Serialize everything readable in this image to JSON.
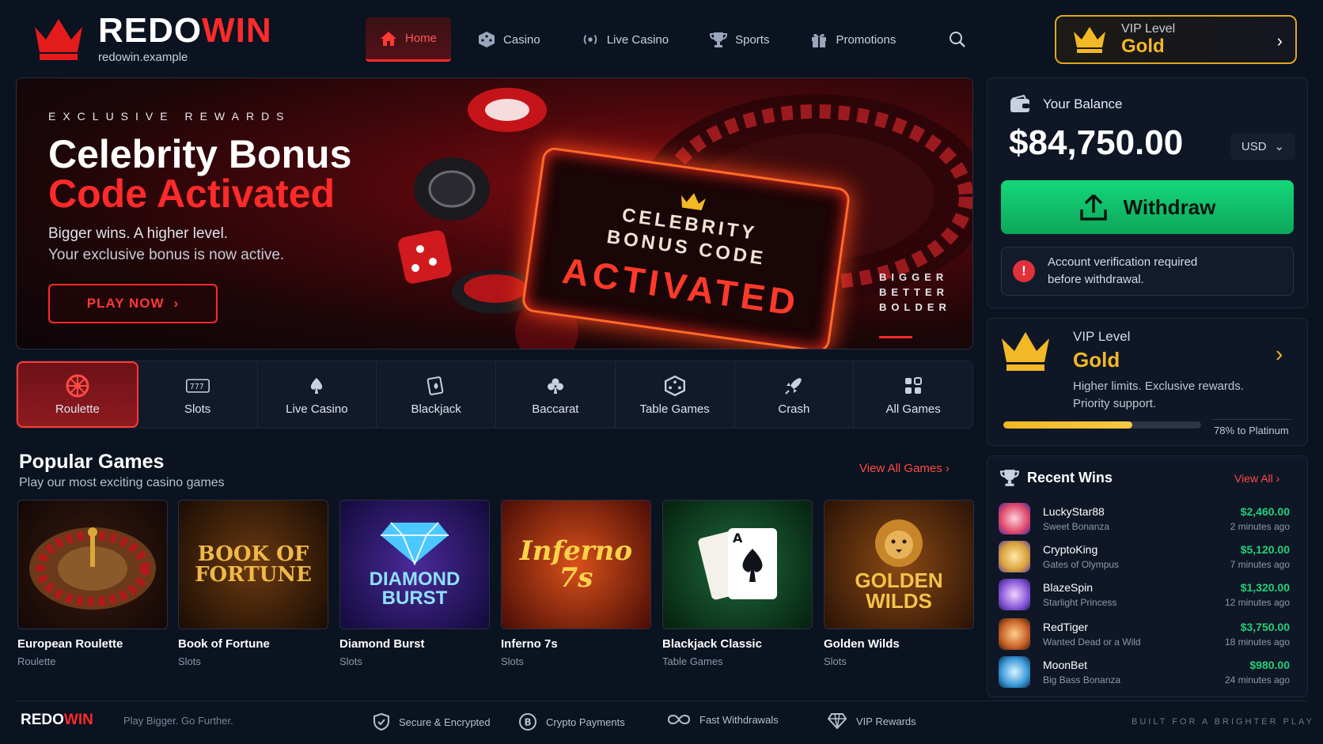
{
  "brand": {
    "word1": "REDO",
    "word2": "WIN",
    "domain": "redowin.example"
  },
  "nav": {
    "items": [
      {
        "label": "Home",
        "icon": "home-icon"
      },
      {
        "label": "Casino",
        "icon": "dice-icon"
      },
      {
        "label": "Live Casino",
        "icon": "broadcast-icon"
      },
      {
        "label": "Sports",
        "icon": "trophy-icon"
      },
      {
        "label": "Promotions",
        "icon": "gift-icon"
      }
    ],
    "active": "Home",
    "search_icon": "search-icon"
  },
  "vip_header": {
    "label": "VIP Level",
    "level": "Gold"
  },
  "hero": {
    "kicker": "EXCLUSIVE REWARDS",
    "title_line1": "Celebrity Bonus",
    "title_line2": "Code Activated",
    "sub1": "Bigger wins. A higher level.",
    "sub2": "Your exclusive bonus is now active.",
    "cta": "PLAY NOW",
    "ticket_line1": "CELEBRITY",
    "ticket_line2": "BONUS CODE",
    "ticket_line3": "ACTIVATED",
    "side": [
      "BIGGER",
      "BETTER",
      "BOLDER"
    ]
  },
  "categories": [
    {
      "label": "Roulette",
      "icon": "roulette-icon"
    },
    {
      "label": "Slots",
      "icon": "slot-machine-icon"
    },
    {
      "label": "Live Casino",
      "icon": "spade-icon"
    },
    {
      "label": "Blackjack",
      "icon": "cards-icon"
    },
    {
      "label": "Baccarat",
      "icon": "club-icon"
    },
    {
      "label": "Table Games",
      "icon": "dice-icon"
    },
    {
      "label": "Crash",
      "icon": "rocket-icon"
    },
    {
      "label": "All Games",
      "icon": "grid-icon"
    }
  ],
  "popular": {
    "title": "Popular Games",
    "subtitle": "Play our most exciting casino games",
    "view_all": "View All Games",
    "games": [
      {
        "name": "European Roulette",
        "category": "Roulette",
        "thumb_text": ""
      },
      {
        "name": "Book of Fortune",
        "category": "Slots",
        "thumb_text": "BOOK OF FORTUNE"
      },
      {
        "name": "Diamond Burst",
        "category": "Slots",
        "thumb_text": "DIAMOND BURST"
      },
      {
        "name": "Inferno 7s",
        "category": "Slots",
        "thumb_text": "Inferno 7s"
      },
      {
        "name": "Blackjack Classic",
        "category": "Table Games",
        "thumb_text": ""
      },
      {
        "name": "Golden Wilds",
        "category": "Slots",
        "thumb_text": "GOLDEN WILDS"
      }
    ]
  },
  "balance": {
    "label": "Your Balance",
    "amount": "$84,750.00",
    "currency": "USD",
    "withdraw": "Withdraw",
    "verify_line1": "Account verification required",
    "verify_line2": "before withdrawal."
  },
  "vip_card": {
    "label": "VIP Level",
    "level": "Gold",
    "desc1": "Higher limits. Exclusive rewards.",
    "desc2": "Priority support.",
    "progress": 0.65,
    "progress_label": "78% to Platinum"
  },
  "recent_wins": {
    "title": "Recent Wins",
    "view_all": "View All",
    "rows": [
      {
        "user": "LuckyStar88",
        "game": "Sweet Bonanza",
        "amount": "$2,460.00",
        "time": "2 minutes ago",
        "color": "#e24a6a"
      },
      {
        "user": "CryptoKing",
        "game": "Gates of Olympus",
        "amount": "$5,120.00",
        "time": "7 minutes ago",
        "color": "#d9a13a"
      },
      {
        "user": "BlazeSpin",
        "game": "Starlight Princess",
        "amount": "$1,320.00",
        "time": "12 minutes ago",
        "color": "#8a5ad8"
      },
      {
        "user": "RedTiger",
        "game": "Wanted Dead or a Wild",
        "amount": "$3,750.00",
        "time": "18 minutes ago",
        "color": "#c8622a"
      },
      {
        "user": "MoonBet",
        "game": "Big Bass Bonanza",
        "amount": "$980.00",
        "time": "24 minutes ago",
        "color": "#3a9ad8"
      }
    ]
  },
  "footer": {
    "logo1": "REDO",
    "logo2": "WIN",
    "tagline": "Play Bigger. Go Further.",
    "features": [
      "Secure & Encrypted",
      "Crypto Payments",
      "Fast Withdrawals",
      "VIP Rewards"
    ],
    "right": "BUILT FOR A BRIGHTER PLAY"
  },
  "colors": {
    "accent": "#ff2a2a",
    "gold": "#f3b826",
    "green": "#14d87a",
    "bg": "#0b1220"
  }
}
